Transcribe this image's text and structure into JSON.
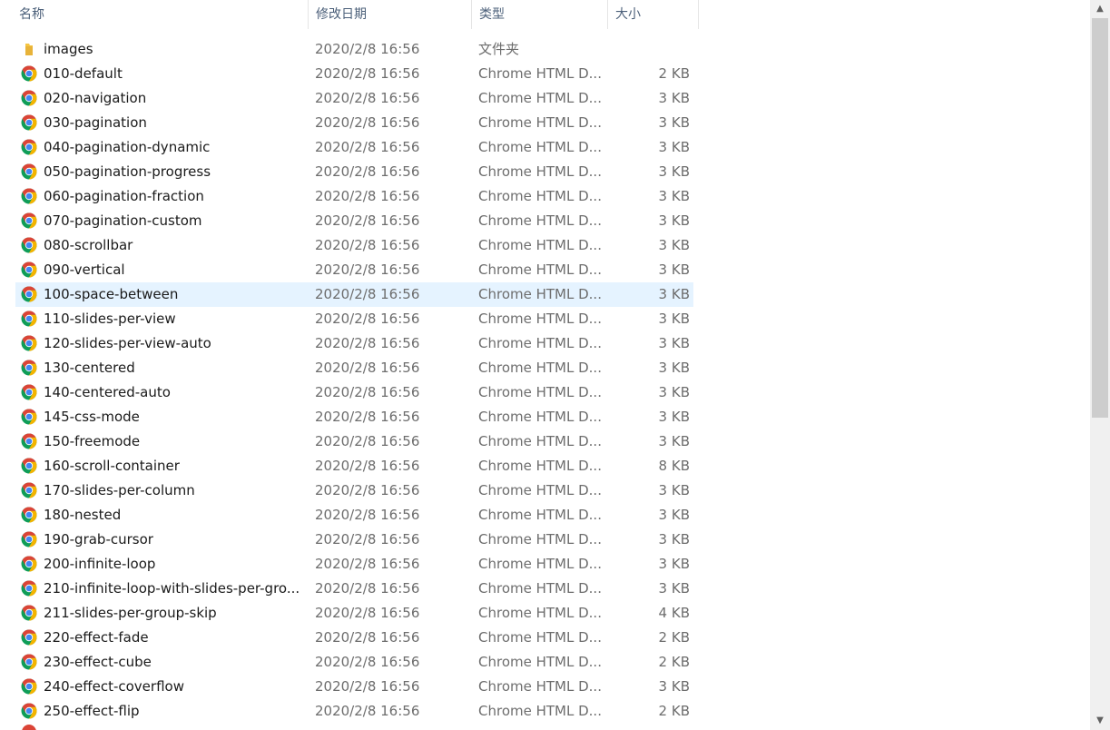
{
  "columns": {
    "name": "名称",
    "date": "修改日期",
    "type": "类型",
    "size": "大小"
  },
  "rows": [
    {
      "name": "images",
      "date": "2020/2/8 16:56",
      "type": "文件夹",
      "size": "",
      "icon": "folder-icon"
    },
    {
      "name": "010-default",
      "date": "2020/2/8 16:56",
      "type": "Chrome HTML D...",
      "size": "2 KB",
      "icon": "chrome-icon"
    },
    {
      "name": "020-navigation",
      "date": "2020/2/8 16:56",
      "type": "Chrome HTML D...",
      "size": "3 KB",
      "icon": "chrome-icon"
    },
    {
      "name": "030-pagination",
      "date": "2020/2/8 16:56",
      "type": "Chrome HTML D...",
      "size": "3 KB",
      "icon": "chrome-icon"
    },
    {
      "name": "040-pagination-dynamic",
      "date": "2020/2/8 16:56",
      "type": "Chrome HTML D...",
      "size": "3 KB",
      "icon": "chrome-icon"
    },
    {
      "name": "050-pagination-progress",
      "date": "2020/2/8 16:56",
      "type": "Chrome HTML D...",
      "size": "3 KB",
      "icon": "chrome-icon"
    },
    {
      "name": "060-pagination-fraction",
      "date": "2020/2/8 16:56",
      "type": "Chrome HTML D...",
      "size": "3 KB",
      "icon": "chrome-icon"
    },
    {
      "name": "070-pagination-custom",
      "date": "2020/2/8 16:56",
      "type": "Chrome HTML D...",
      "size": "3 KB",
      "icon": "chrome-icon"
    },
    {
      "name": "080-scrollbar",
      "date": "2020/2/8 16:56",
      "type": "Chrome HTML D...",
      "size": "3 KB",
      "icon": "chrome-icon"
    },
    {
      "name": "090-vertical",
      "date": "2020/2/8 16:56",
      "type": "Chrome HTML D...",
      "size": "3 KB",
      "icon": "chrome-icon"
    },
    {
      "name": "100-space-between",
      "date": "2020/2/8 16:56",
      "type": "Chrome HTML D...",
      "size": "3 KB",
      "icon": "chrome-icon",
      "selected": true
    },
    {
      "name": "110-slides-per-view",
      "date": "2020/2/8 16:56",
      "type": "Chrome HTML D...",
      "size": "3 KB",
      "icon": "chrome-icon"
    },
    {
      "name": "120-slides-per-view-auto",
      "date": "2020/2/8 16:56",
      "type": "Chrome HTML D...",
      "size": "3 KB",
      "icon": "chrome-icon"
    },
    {
      "name": "130-centered",
      "date": "2020/2/8 16:56",
      "type": "Chrome HTML D...",
      "size": "3 KB",
      "icon": "chrome-icon"
    },
    {
      "name": "140-centered-auto",
      "date": "2020/2/8 16:56",
      "type": "Chrome HTML D...",
      "size": "3 KB",
      "icon": "chrome-icon"
    },
    {
      "name": "145-css-mode",
      "date": "2020/2/8 16:56",
      "type": "Chrome HTML D...",
      "size": "3 KB",
      "icon": "chrome-icon"
    },
    {
      "name": "150-freemode",
      "date": "2020/2/8 16:56",
      "type": "Chrome HTML D...",
      "size": "3 KB",
      "icon": "chrome-icon"
    },
    {
      "name": "160-scroll-container",
      "date": "2020/2/8 16:56",
      "type": "Chrome HTML D...",
      "size": "8 KB",
      "icon": "chrome-icon"
    },
    {
      "name": "170-slides-per-column",
      "date": "2020/2/8 16:56",
      "type": "Chrome HTML D...",
      "size": "3 KB",
      "icon": "chrome-icon"
    },
    {
      "name": "180-nested",
      "date": "2020/2/8 16:56",
      "type": "Chrome HTML D...",
      "size": "3 KB",
      "icon": "chrome-icon"
    },
    {
      "name": "190-grab-cursor",
      "date": "2020/2/8 16:56",
      "type": "Chrome HTML D...",
      "size": "3 KB",
      "icon": "chrome-icon"
    },
    {
      "name": "200-infinite-loop",
      "date": "2020/2/8 16:56",
      "type": "Chrome HTML D...",
      "size": "3 KB",
      "icon": "chrome-icon"
    },
    {
      "name": "210-infinite-loop-with-slides-per-gro...",
      "date": "2020/2/8 16:56",
      "type": "Chrome HTML D...",
      "size": "3 KB",
      "icon": "chrome-icon"
    },
    {
      "name": "211-slides-per-group-skip",
      "date": "2020/2/8 16:56",
      "type": "Chrome HTML D...",
      "size": "4 KB",
      "icon": "chrome-icon"
    },
    {
      "name": "220-effect-fade",
      "date": "2020/2/8 16:56",
      "type": "Chrome HTML D...",
      "size": "2 KB",
      "icon": "chrome-icon"
    },
    {
      "name": "230-effect-cube",
      "date": "2020/2/8 16:56",
      "type": "Chrome HTML D...",
      "size": "2 KB",
      "icon": "chrome-icon"
    },
    {
      "name": "240-effect-coverflow",
      "date": "2020/2/8 16:56",
      "type": "Chrome HTML D...",
      "size": "3 KB",
      "icon": "chrome-icon"
    },
    {
      "name": "250-effect-flip",
      "date": "2020/2/8 16:56",
      "type": "Chrome HTML D...",
      "size": "2 KB",
      "icon": "chrome-icon"
    }
  ],
  "colors": {
    "header_text": "#4c607a",
    "row_text": "#1a1a1a",
    "meta_text": "#6d6d6d",
    "selection": "#e5f3ff",
    "folder": "#f5c542"
  }
}
